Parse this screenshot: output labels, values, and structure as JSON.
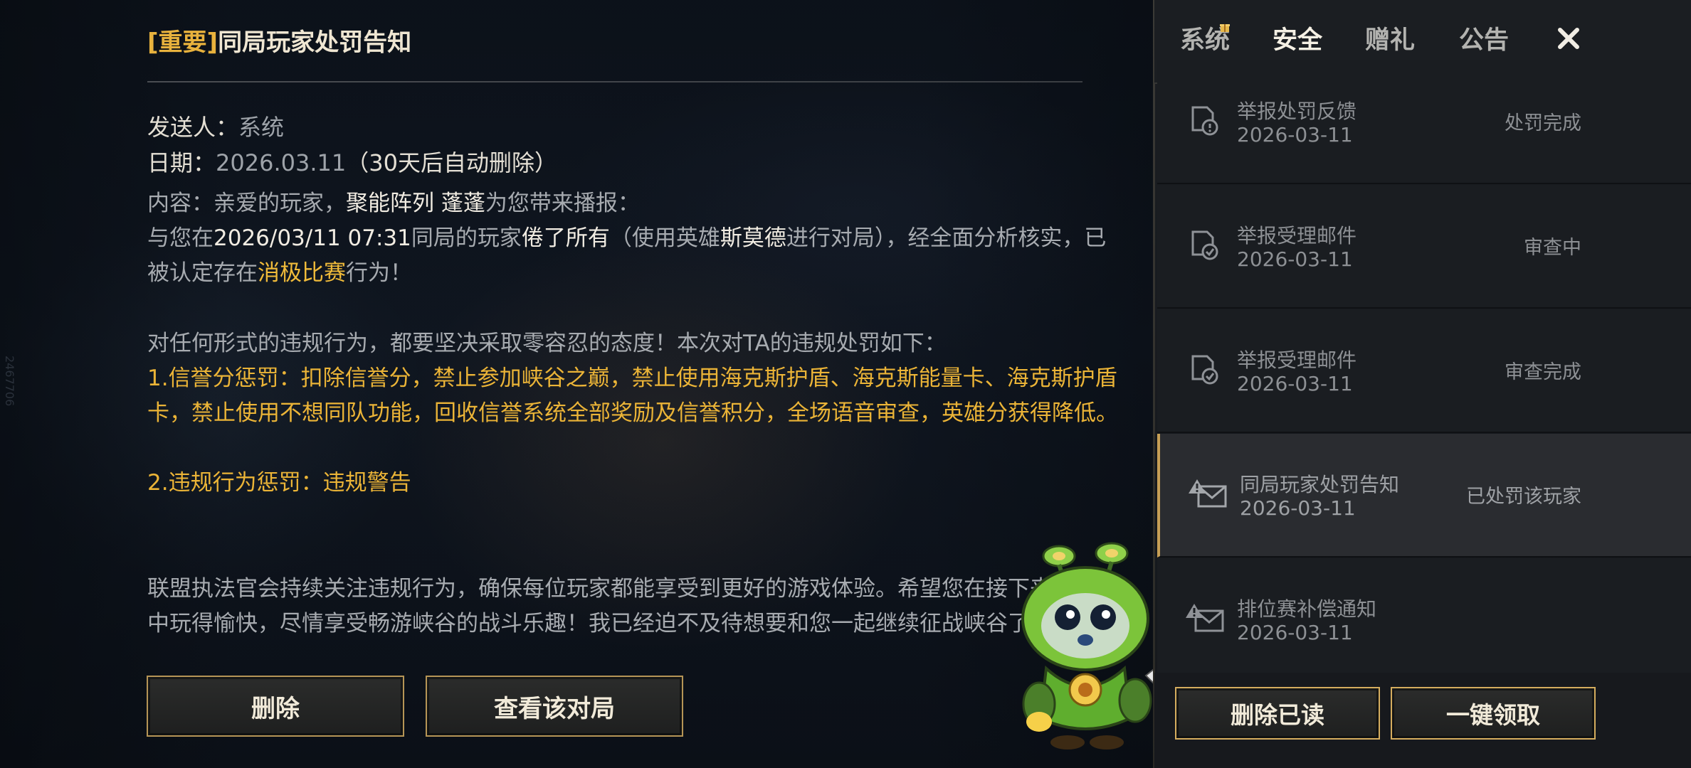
{
  "mail": {
    "title_tag": "[重要]",
    "title": "同局玩家处罚告知",
    "sender_label": "发送人：",
    "sender_value": "系统",
    "date_label": "日期：",
    "date_value": "2026.03.11",
    "date_note": "（30天后自动删除）",
    "content": {
      "p1_a": "内容：亲爱的玩家，",
      "p1_b": "聚能阵列 蓬蓬",
      "p1_c": "为您带来播报：",
      "p2_a": "与您在",
      "p2_b": "2026/03/11 07:31",
      "p2_c": "同局的玩家",
      "p2_d": "倦了所有",
      "p2_e": "（使用英雄",
      "p2_f": "斯莫德",
      "p2_g": "进行对局），经全面分析核实，已被认定存在",
      "p2_h": "消极比赛",
      "p2_i": "行为！",
      "p3": "对任何形式的违规行为，都要坚决采取零容忍的态度！本次对TA的违规处罚如下：",
      "penalty1": "1.信誉分惩罚：扣除信誉分，禁止参加峡谷之巅，禁止使用海克斯护盾、海克斯能量卡、海克斯护盾卡，禁止使用不想同队功能，回收信誉系统全部奖励及信誉积分，全场语音审查，英雄分获得降低。",
      "penalty2": "2.违规行为惩罚：违规警告",
      "closing": "联盟执法官会持续关注违规行为，确保每位玩家都能享受到更好的游戏体验。希望您在接下来的游戏中玩得愉快，尽情享受畅游峡谷的战斗乐趣！我已经迫不及待想要和您一起继续征战峡谷了"
    },
    "buttons": {
      "delete": "删除",
      "view_match": "查看该对局"
    }
  },
  "side_tag": "2467706",
  "tabs": [
    {
      "label": "系统",
      "active": false
    },
    {
      "label": "安全",
      "active": true
    },
    {
      "label": "赠礼",
      "active": false
    },
    {
      "label": "公告",
      "active": false
    }
  ],
  "mail_list": [
    {
      "name": "举报处罚反馈",
      "date": "2026-03-11",
      "status": "处罚完成",
      "icon": "report-penalty-icon",
      "selected": false
    },
    {
      "name": "举报受理邮件",
      "date": "2026-03-11",
      "status": "审查中",
      "icon": "report-accepted-icon",
      "selected": false
    },
    {
      "name": "举报受理邮件",
      "date": "2026-03-11",
      "status": "审查完成",
      "icon": "report-accepted-icon",
      "selected": false
    },
    {
      "name": "同局玩家处罚告知",
      "date": "2026-03-11",
      "status": "已处罚该玩家",
      "icon": "warning-mail-icon",
      "selected": true
    },
    {
      "name": "排位赛补偿通知",
      "date": "2026-03-11",
      "status": "",
      "icon": "warning-mail-icon",
      "selected": false
    }
  ],
  "panel_buttons": {
    "delete_read": "删除已读",
    "claim_all": "一键领取"
  },
  "colors": {
    "accent_gold": "#e8b23d",
    "button_border": "#b69556"
  }
}
